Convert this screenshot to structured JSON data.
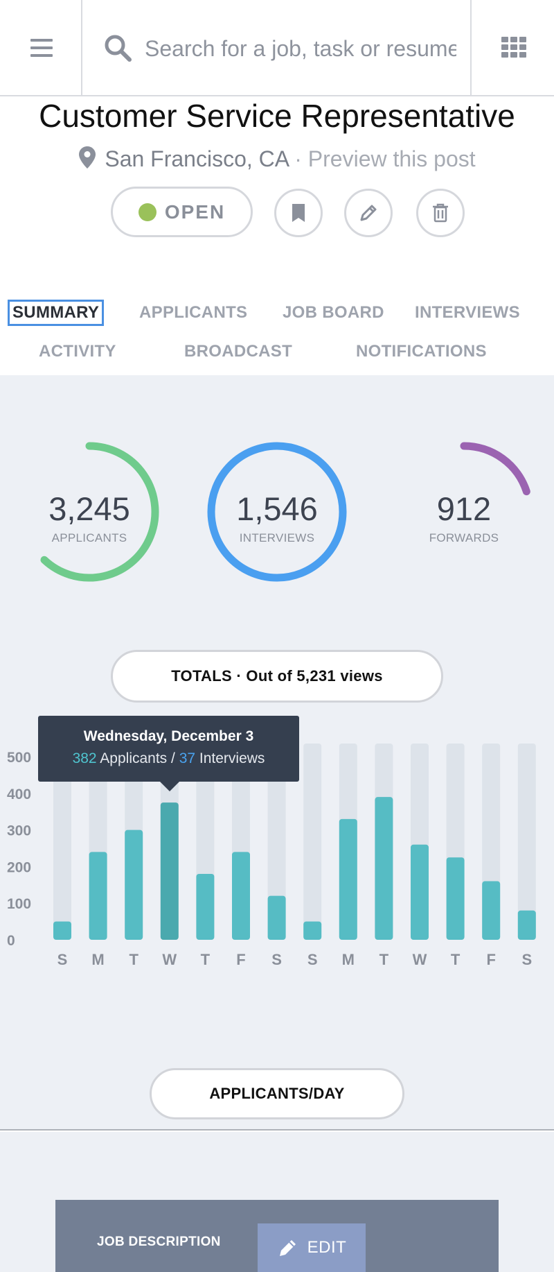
{
  "search": {
    "placeholder": "Search for a job, task or resume"
  },
  "job": {
    "title": "Customer Service Representative",
    "location": "San Francisco, CA",
    "separator": "·",
    "preview_link": "Preview this post",
    "status": "OPEN",
    "status_color": "#9ac15a"
  },
  "tabs": [
    "SUMMARY",
    "APPLICANTS",
    "JOB BOARD",
    "INTERVIEWS",
    "ACTIVITY",
    "BROADCAST",
    "NOTIFICATIONS"
  ],
  "active_tab": "SUMMARY",
  "stats": {
    "applicants": {
      "value": "3,245",
      "label": "APPLICANTS",
      "color": "#6fcb8c",
      "progress": 0.62
    },
    "interviews": {
      "value": "1,546",
      "label": "INTERVIEWS",
      "color": "#4a9ff0",
      "progress": 1.0
    },
    "forwards": {
      "value": "912",
      "label": "FORWARDS",
      "color": "#9b63b1",
      "progress": 0.2
    }
  },
  "totals_pill": "TOTALS · Out of 5,231 views",
  "tooltip": {
    "date": "Wednesday, December 3",
    "applicants": "382",
    "applicants_label": "Applicants /",
    "interviews": "37",
    "interviews_label": "Interviews"
  },
  "applicants_day_pill": "APPLICANTS/DAY",
  "chart_data": {
    "type": "bar",
    "categories": [
      "S",
      "M",
      "T",
      "W",
      "T",
      "F",
      "S",
      "S",
      "M",
      "T",
      "W",
      "T",
      "F",
      "S"
    ],
    "values": [
      50,
      240,
      300,
      375,
      180,
      240,
      120,
      50,
      330,
      390,
      260,
      225,
      160,
      80
    ],
    "ylim": [
      0,
      540
    ],
    "yticks": [
      0,
      100,
      200,
      300,
      400,
      500
    ],
    "highlight_index": 3,
    "colors": {
      "bar": "#56bcc4",
      "highlight": "#4aa9ae",
      "track": "#dde3ea",
      "axis_text": "#8a8f99"
    },
    "title": "",
    "xlabel": "",
    "ylabel": ""
  },
  "bottom": {
    "job_description": "JOB DESCRIPTION",
    "edit": "EDIT"
  }
}
